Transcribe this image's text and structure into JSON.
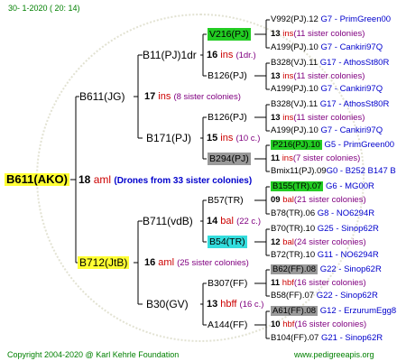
{
  "header": "30-   1-2020  ( 20:  14)",
  "root": {
    "id": "B611(AKO)",
    "year": "18",
    "breeder": " aml",
    "note": "(Drones from 33 sister colonies)"
  },
  "g2": [
    {
      "id": "B611(JG)",
      "year": "17",
      "breeder": " ins",
      "note": "(8 sister colonies)"
    },
    {
      "id": "B712(JtB)",
      "year": "16",
      "breeder": " aml",
      "note": "(25 sister colonies)"
    }
  ],
  "g3": [
    {
      "id": "B11(PJ)1dr",
      "year": "16",
      "breeder": " ins",
      "note": "(1dr.)"
    },
    {
      "id": "B171(PJ)",
      "year": "15",
      "breeder": " ins",
      "note": "(10 c.)"
    },
    {
      "id": "B711(vdB)",
      "year": "14",
      "breeder": " bal",
      "note": "(22 c.)"
    },
    {
      "id": "B30(GV)",
      "year": "13",
      "breeder": " hbff",
      "note": "(16 c.)"
    }
  ],
  "g4": [
    "V216(PJ)",
    "B126(PJ)",
    "B126(PJ)",
    "B294(PJ)",
    "B57(TR)",
    "B54(TR)",
    "B307(FF)",
    "A144(FF)"
  ],
  "g5": [
    {
      "id": "V992(PJ).12",
      "extra": "G7 - PrimGreen00"
    },
    {
      "year": "13",
      "breeder": "ins",
      "note": "(11 sister colonies)"
    },
    {
      "id": "A199(PJ).10",
      "extra": "G7 - Cankiri97Q"
    },
    {
      "id": "B328(VJ).11",
      "extra": "G17 - AthosSt80R"
    },
    {
      "year": "13",
      "breeder": "ins",
      "note": "(11 sister colonies)"
    },
    {
      "id": "A199(PJ).10",
      "extra": "G7 - Cankiri97Q"
    },
    {
      "id": "B328(VJ).11",
      "extra": "G17 - AthosSt80R"
    },
    {
      "year": "13",
      "breeder": "ins",
      "note": "(11 sister colonies)"
    },
    {
      "id": "A199(PJ).10",
      "extra": "G7 - Cankiri97Q"
    },
    {
      "id": "P216(PJ).10",
      "extra": "G5 - PrimGreen00"
    },
    {
      "year": "11",
      "breeder": "ins",
      "note": "(7 sister colonies)"
    },
    {
      "id": "Bmix11(PJ).09",
      "extra": "G0 - B252 B147 B"
    },
    {
      "id": "B155(TR).07",
      "extra": "G6 - MG00R"
    },
    {
      "year": "09",
      "breeder": "bal",
      "note": "(21 sister colonies)"
    },
    {
      "id": "B78(TR).06",
      "extra": "G8 - NO6294R"
    },
    {
      "id": "B70(TR).10",
      "extra": "G25 - Sinop62R"
    },
    {
      "year": "12",
      "breeder": "bal",
      "note": "(24 sister colonies)"
    },
    {
      "id": "B72(TR).10",
      "extra": "G11 - NO6294R"
    },
    {
      "id": "B62(FF).08",
      "extra": "G22 - Sinop62R"
    },
    {
      "year": "11",
      "breeder": "hbf",
      "note": "(16 sister colonies)"
    },
    {
      "id": "B58(FF).07",
      "extra": "G22 - Sinop62R"
    },
    {
      "id": "A61(FF).08",
      "extra": "G12 - ErzurumEgg8"
    },
    {
      "year": "10",
      "breeder": "hbf",
      "note": "(16 sister colonies)"
    },
    {
      "id": "B104(FF).07",
      "extra": "G21 - Sinop62R"
    }
  ],
  "footer": {
    "copyright": "Copyright 2004-2020 @ Karl Kehrle Foundation",
    "url": "www.pedigreeapis.org"
  }
}
